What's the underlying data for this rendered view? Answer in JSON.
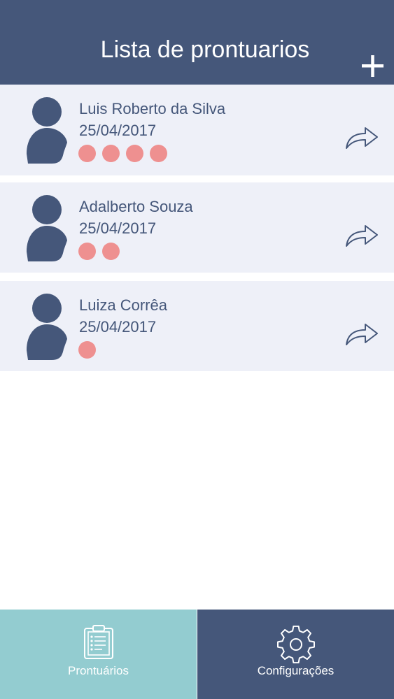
{
  "header": {
    "title": "Lista de prontuarios",
    "add_icon": "plus-icon"
  },
  "records": [
    {
      "name": "Luis Roberto da Silva",
      "date": "25/04/2017",
      "dots": 4
    },
    {
      "name": "Adalberto Souza",
      "date": "25/04/2017",
      "dots": 2
    },
    {
      "name": "Luiza Corrêa",
      "date": "25/04/2017",
      "dots": 1
    }
  ],
  "tabs": [
    {
      "label": "Prontuários",
      "icon": "clipboard-icon",
      "active": true
    },
    {
      "label": "Configurações",
      "icon": "gear-icon",
      "active": false
    }
  ],
  "colors": {
    "primary": "#45577a",
    "card_bg": "#eef0f8",
    "dot": "#ee9090",
    "active_tab": "#93ccd0"
  }
}
